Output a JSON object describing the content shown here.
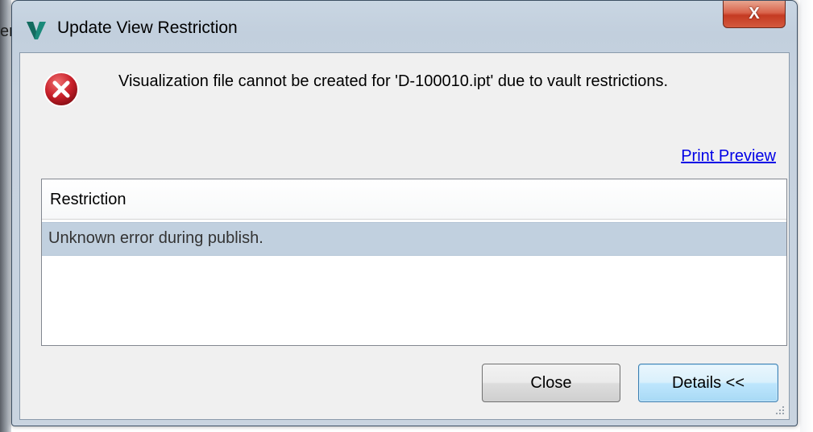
{
  "background": {
    "cut_text": "er"
  },
  "window": {
    "title": "Update View Restriction",
    "close_glyph": "X"
  },
  "dialog": {
    "message": "Visualization file cannot be created for 'D-100010.ipt' due to vault restrictions.",
    "print_preview_label": "Print Preview",
    "list": {
      "header": "Restriction",
      "rows": [
        "Unknown error during publish."
      ]
    },
    "buttons": {
      "close_label": "Close",
      "details_label": "Details <<"
    }
  },
  "icons": {
    "app": "vault-v-icon",
    "error": "error-icon",
    "close": "close-icon",
    "grip": "resize-grip-icon"
  },
  "colors": {
    "app_icon": "#1a8a7a",
    "error_red": "#c8202a",
    "link": "#0000e6",
    "selected_row": "#c1d0df"
  }
}
